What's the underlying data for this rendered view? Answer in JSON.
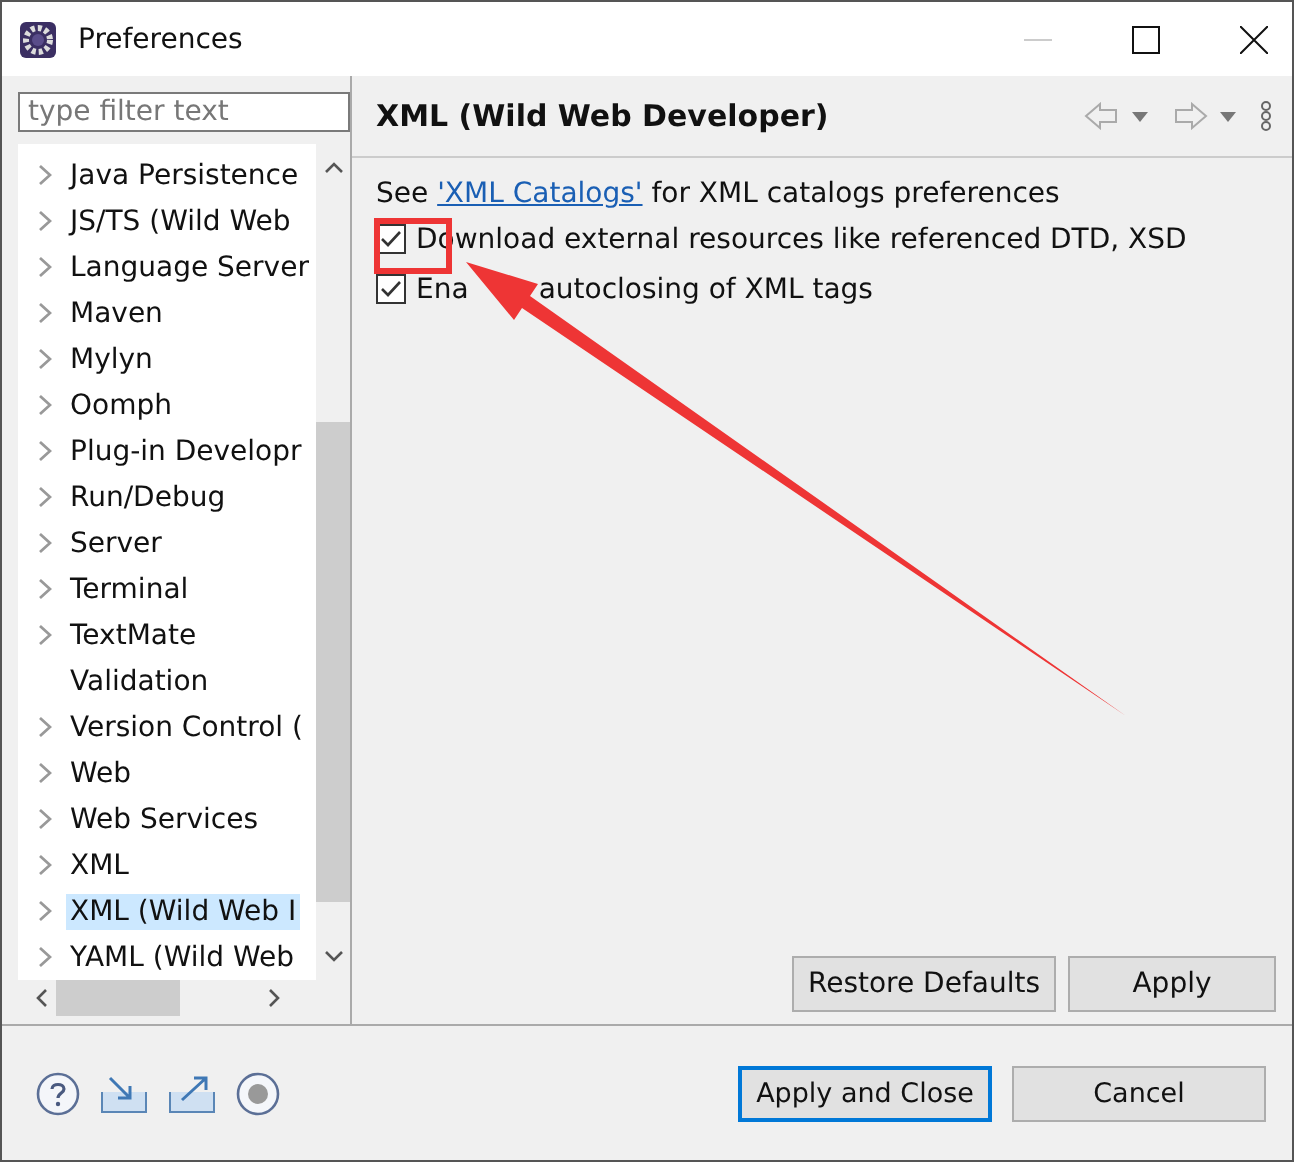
{
  "window": {
    "title": "Preferences"
  },
  "filter": {
    "placeholder": "type filter text"
  },
  "tree": [
    {
      "label": "Java Persistence",
      "expandable": true,
      "selected": false
    },
    {
      "label": "JS/TS (Wild Web",
      "expandable": true,
      "selected": false
    },
    {
      "label": "Language Server",
      "expandable": true,
      "selected": false
    },
    {
      "label": "Maven",
      "expandable": true,
      "selected": false
    },
    {
      "label": "Mylyn",
      "expandable": true,
      "selected": false
    },
    {
      "label": "Oomph",
      "expandable": true,
      "selected": false
    },
    {
      "label": "Plug-in Developr",
      "expandable": true,
      "selected": false
    },
    {
      "label": "Run/Debug",
      "expandable": true,
      "selected": false
    },
    {
      "label": "Server",
      "expandable": true,
      "selected": false
    },
    {
      "label": "Terminal",
      "expandable": true,
      "selected": false
    },
    {
      "label": "TextMate",
      "expandable": true,
      "selected": false
    },
    {
      "label": "Validation",
      "expandable": false,
      "selected": false
    },
    {
      "label": "Version Control (",
      "expandable": true,
      "selected": false
    },
    {
      "label": "Web",
      "expandable": true,
      "selected": false
    },
    {
      "label": "Web Services",
      "expandable": true,
      "selected": false
    },
    {
      "label": "XML",
      "expandable": true,
      "selected": false
    },
    {
      "label": "XML (Wild Web I",
      "expandable": true,
      "selected": true
    },
    {
      "label": "YAML (Wild Web",
      "expandable": true,
      "selected": false
    }
  ],
  "page": {
    "title": "XML (Wild Web Developer)",
    "intro": {
      "before": "See ",
      "link": "'XML Catalogs'",
      "after": " for XML catalogs preferences"
    },
    "options": [
      {
        "label": "Download external resources like referenced DTD, XSD",
        "checked": true
      },
      {
        "label": "Ena",
        "label_rest": "autoclosing of XML tags",
        "checked": true
      }
    ],
    "buttons": [
      "Restore Defaults",
      "Apply"
    ]
  },
  "footer": {
    "buttons": [
      {
        "label": "Apply and Close",
        "default": true
      },
      {
        "label": "Cancel",
        "default": false
      }
    ]
  }
}
